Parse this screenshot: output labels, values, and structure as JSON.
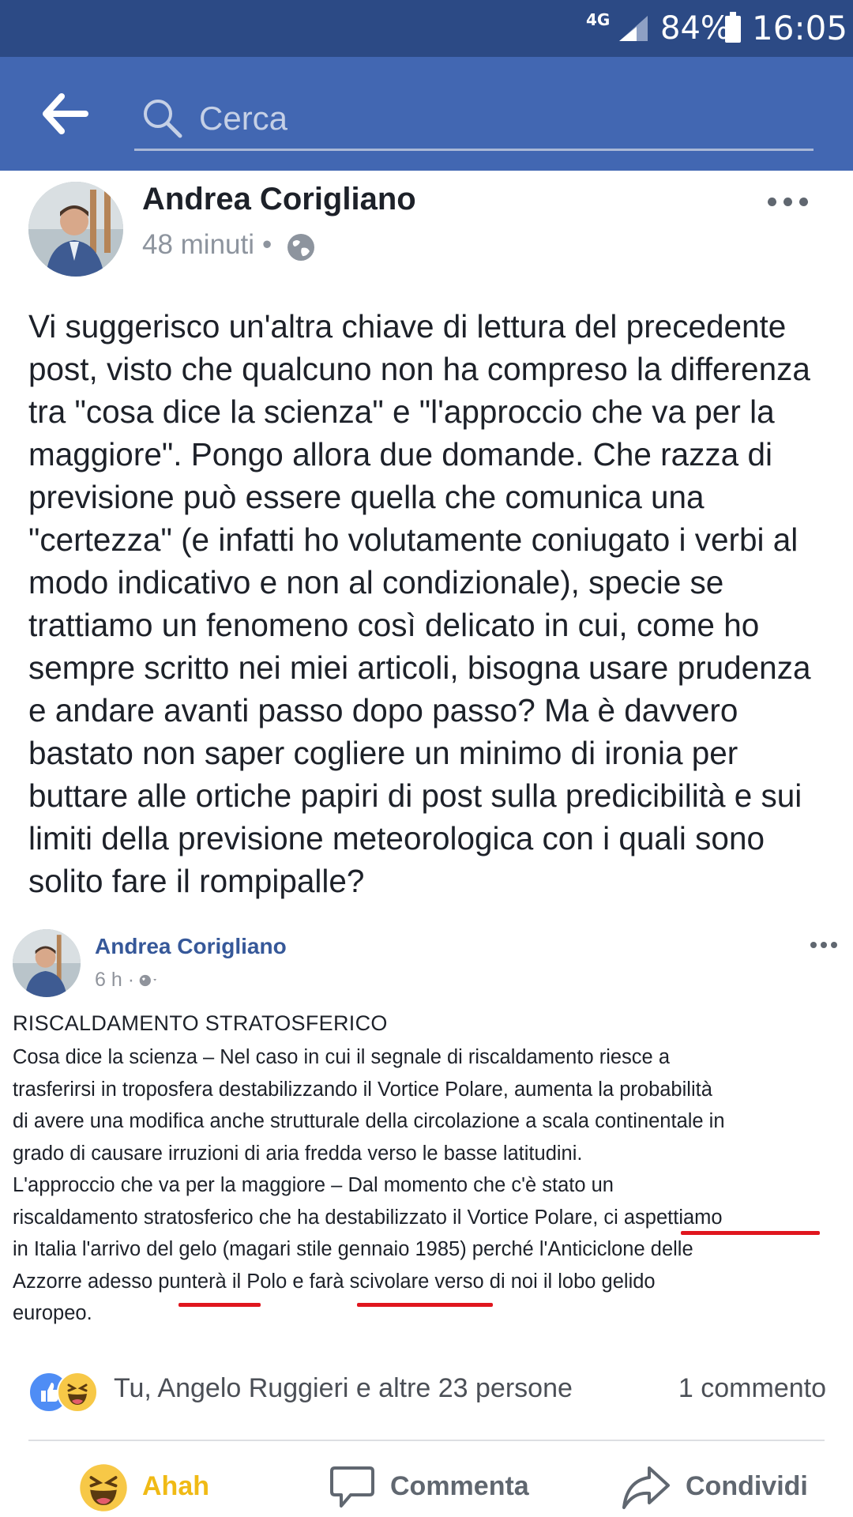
{
  "status_bar": {
    "network": "4G",
    "battery": "84%",
    "time": "16:05"
  },
  "app_bar": {
    "search_placeholder": "Cerca"
  },
  "post": {
    "author": "Andrea Corigliano",
    "time": "48 minuti",
    "separator": "•",
    "privacy_icon": "globe-icon",
    "text": "Vi suggerisco un'altra chiave di lettura del precedente post, visto che qualcuno non ha compreso la differenza tra \"cosa dice la scienza\" e \"l'approccio che va per la maggiore\". Pongo allora due domande. Che razza di previsione può essere quella che comunica una \"certezza\" (e infatti ho volutamente coniugato i verbi al modo indicativo e non al condizionale), specie se trattiamo un fenomeno così delicato in cui, come ho sempre scritto nei miei articoli, bisogna usare prudenza e andare avanti passo dopo passo? Ma è davvero bastato non saper cogliere un minimo di ironia per buttare alle ortiche papiri di post sulla predicibilità e sui limiti della previsione meteorologica con i quali sono solito fare il rompipalle?"
  },
  "embedded_post": {
    "author": "Andrea Corigliano",
    "time": "6 h ·",
    "title": "RISCALDAMENTO STRATOSFERICO",
    "lines": [
      "Cosa dice la scienza – Nel caso in cui il segnale di riscaldamento riesce a",
      "trasferirsi in troposfera destabilizzando il Vortice Polare, aumenta la probabilità",
      "di avere una modifica anche strutturale della circolazione a scala continentale in",
      "grado di causare irruzioni di aria fredda verso le basse latitudini.",
      "L'approccio che va per la maggiore – Dal momento che c'è stato un",
      "riscaldamento stratosferico che ha destabilizzato il Vortice Polare, ci aspettiamo",
      "in Italia l'arrivo del gelo (magari stile gennaio 1985) perché l'Anticiclone delle",
      "Azzorre adesso punterà il Polo e farà scivolare verso di noi il lobo gelido",
      "europeo."
    ],
    "underline_color": "#e0161e"
  },
  "reactions": {
    "summary": "Tu, Angelo Ruggieri e altre 23 persone",
    "comments": "1 commento"
  },
  "actions": {
    "reaction_label": "Ahah",
    "comment_label": "Commenta",
    "share_label": "Condividi"
  },
  "colors": {
    "status_bar": "#2c4a85",
    "app_bar": "#4267b2",
    "haha_accent": "#f0ba15"
  }
}
